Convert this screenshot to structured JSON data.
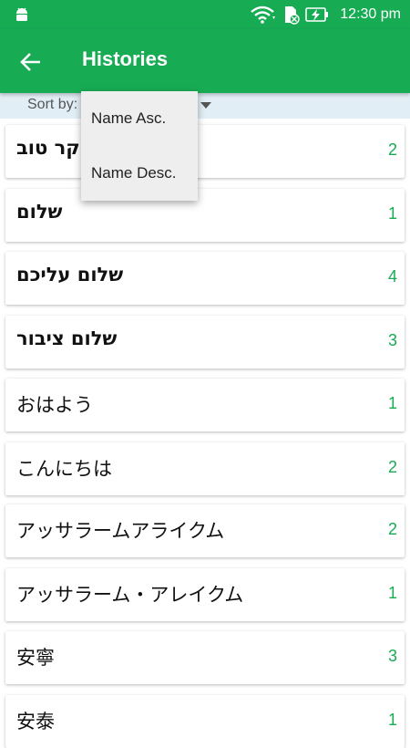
{
  "status_bar": {
    "time": "12:30 pm",
    "icons": [
      "android-icon",
      "wifi-icon",
      "sd-card-icon",
      "battery-charging-icon"
    ]
  },
  "app_bar": {
    "title": "Histories",
    "back_icon": "arrow-left-icon"
  },
  "sort": {
    "label": "Sort by:",
    "options": [
      "Name Asc.",
      "Name Desc."
    ]
  },
  "items": [
    {
      "name": "בוקר טוב",
      "count": "2"
    },
    {
      "name": "שלום",
      "count": "1"
    },
    {
      "name": "שלום עליכם",
      "count": "4"
    },
    {
      "name": "שלום ציבור",
      "count": "3"
    },
    {
      "name": "おはよう",
      "count": "1"
    },
    {
      "name": "こんにちは",
      "count": "2"
    },
    {
      "name": "アッサラームアライクム",
      "count": "2"
    },
    {
      "name": "アッサラーム・アレイクム",
      "count": "1"
    },
    {
      "name": "安寧",
      "count": "3"
    },
    {
      "name": "安泰",
      "count": "1"
    }
  ],
  "colors": {
    "primary": "#17ab54",
    "sort_bar_bg": "#e2eef5",
    "dropdown_bg": "#eeeeee"
  }
}
